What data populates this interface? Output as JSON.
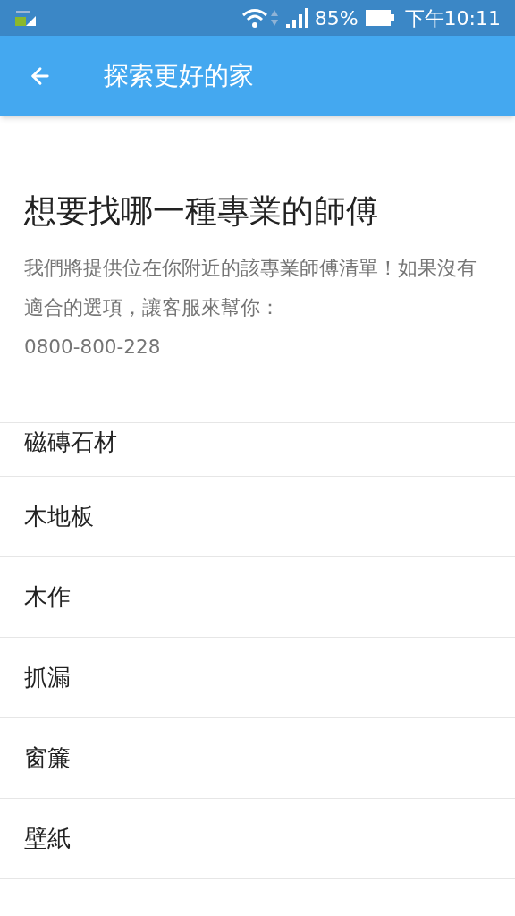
{
  "status_bar": {
    "battery_percent": "85%",
    "time": "下午10:11"
  },
  "app_bar": {
    "title": "探索更好的家"
  },
  "heading": "想要找哪一種專業的師傅",
  "description": "我們將提供位在你附近的該專業師傅清單！如果沒有適合的選項，讓客服來幫你：",
  "phone": "0800-800-228",
  "categories": [
    {
      "label": "磁磚石材"
    },
    {
      "label": "木地板"
    },
    {
      "label": "木作"
    },
    {
      "label": "抓漏"
    },
    {
      "label": "窗簾"
    },
    {
      "label": "壁紙"
    }
  ]
}
